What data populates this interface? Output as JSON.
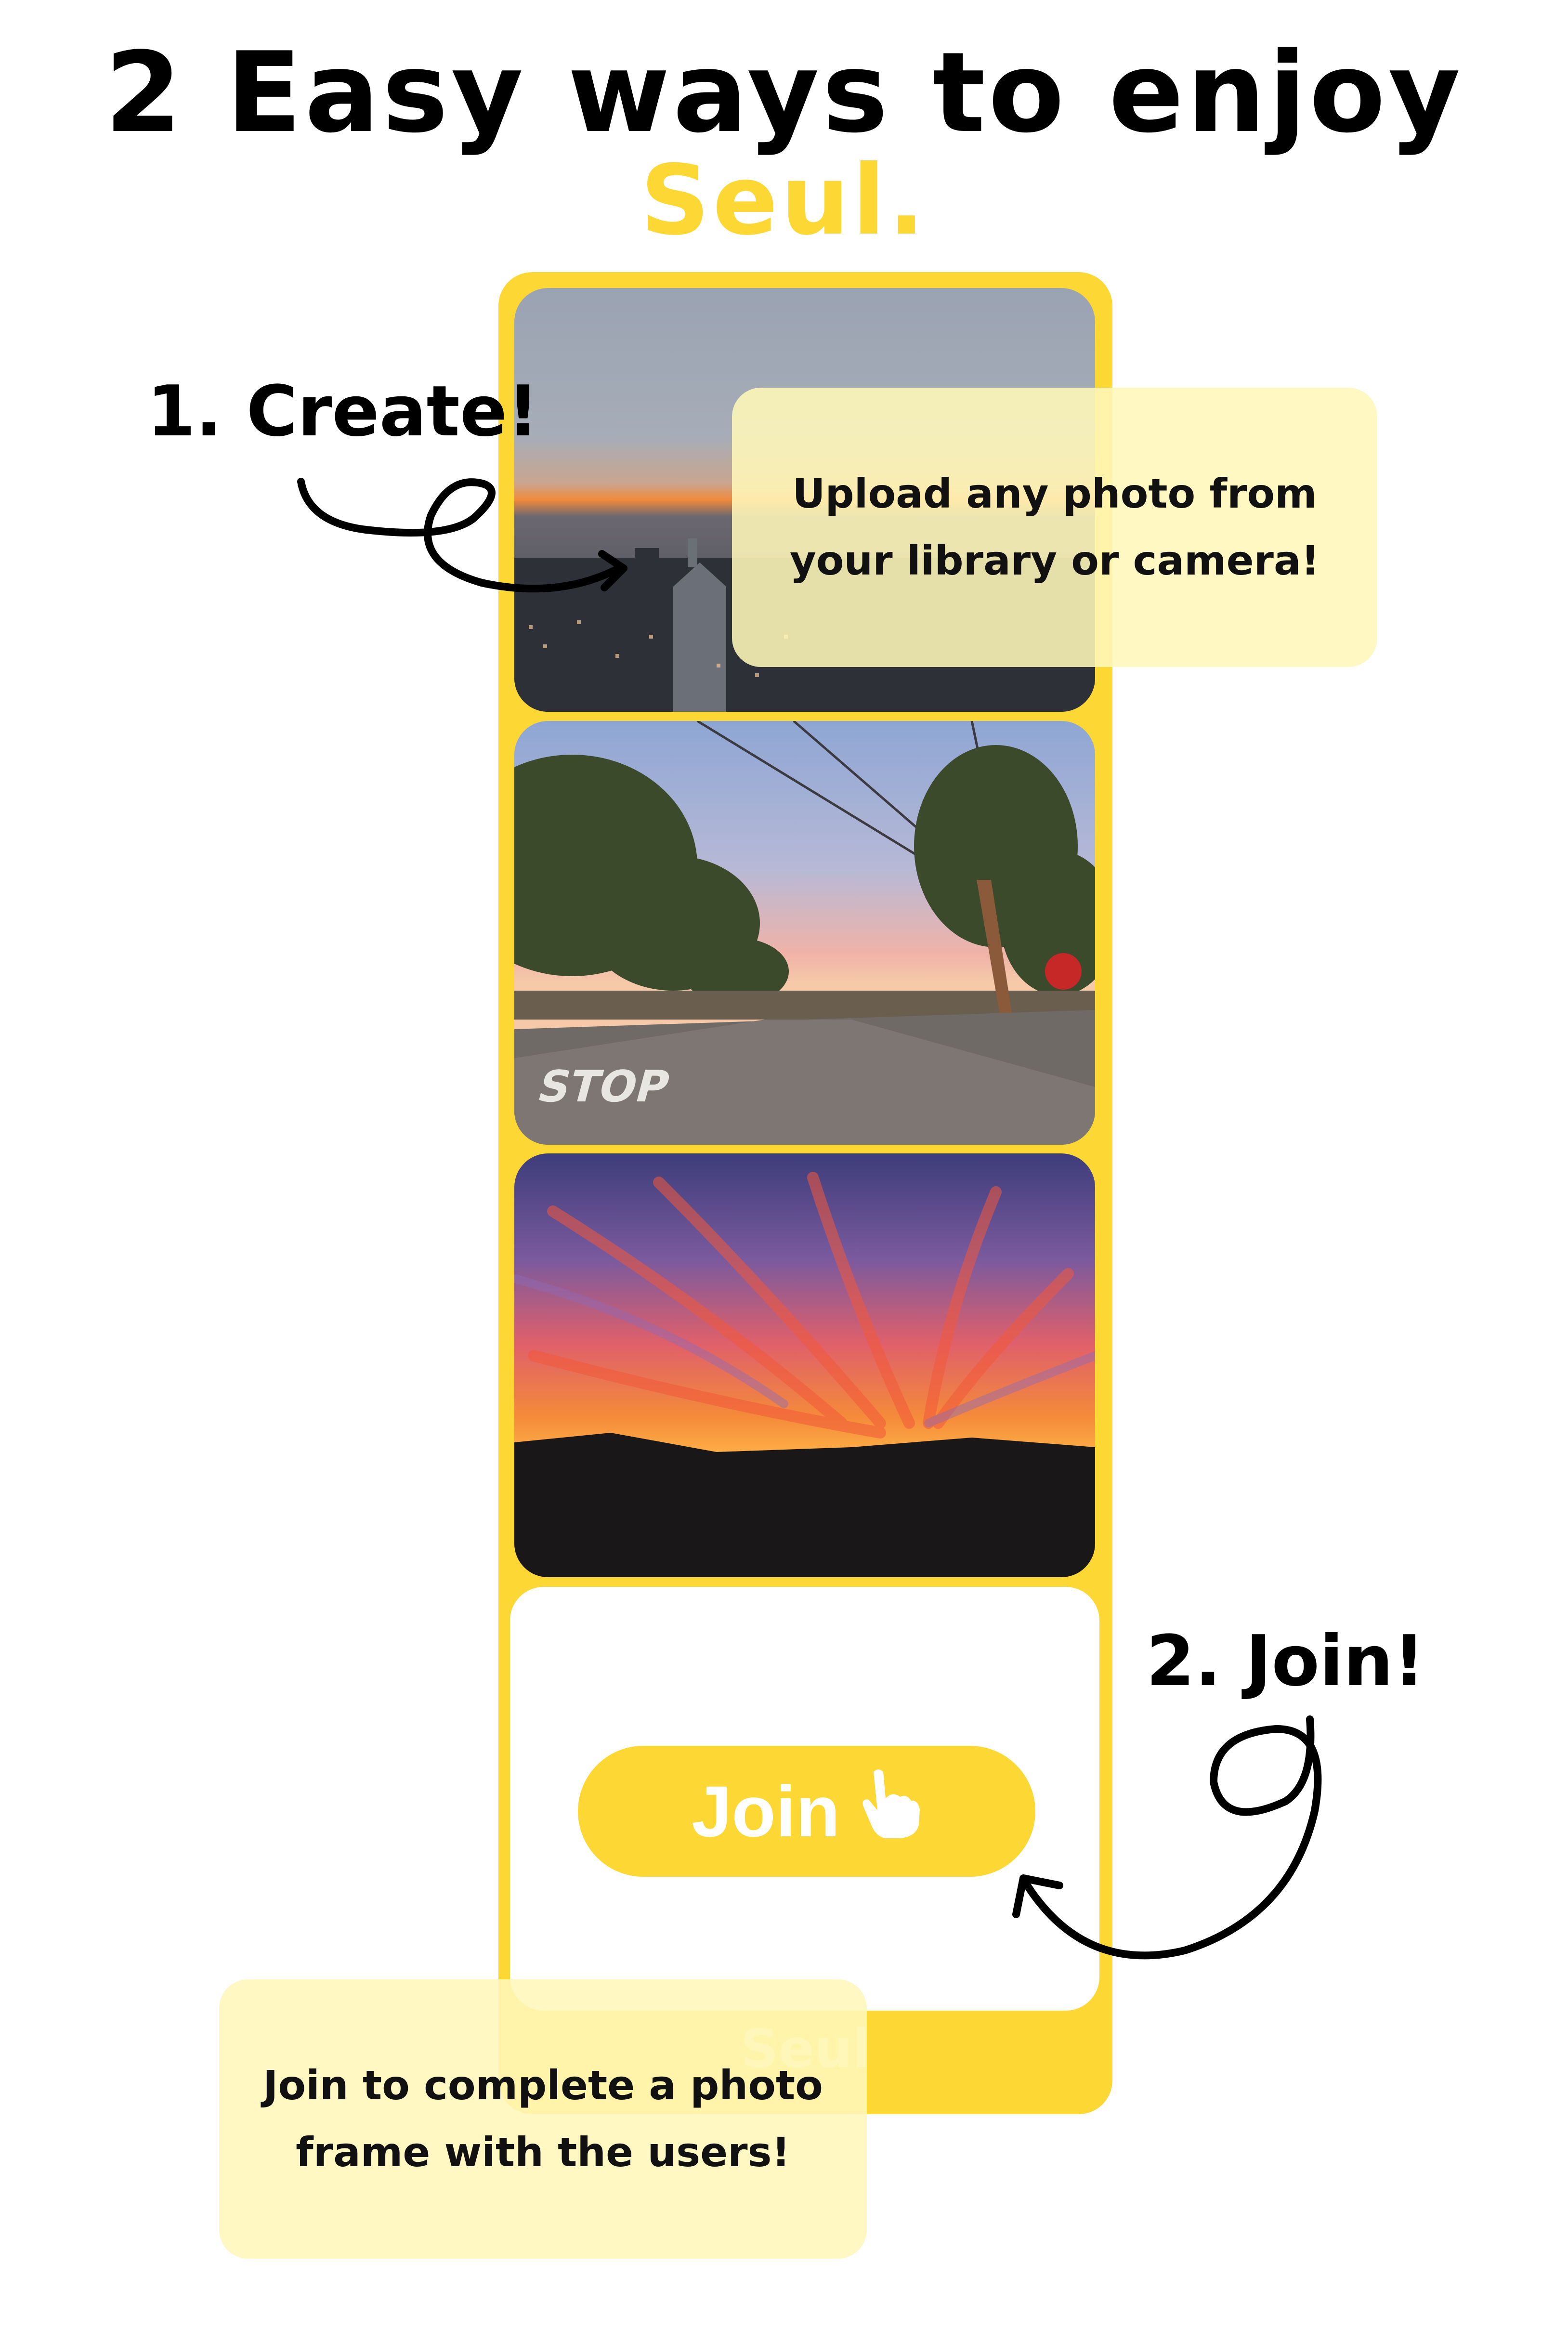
{
  "header": {
    "title_line1": "2 Easy ways to enjoy",
    "title_line2": "Seul."
  },
  "steps": {
    "create_label": "1. Create!",
    "create_description": "Upload any photo from your library or camera!",
    "join_label": "2. Join!",
    "join_description": "Join to complete a photo frame with the users!"
  },
  "frame": {
    "join_button_label": "Join",
    "join_button_icon": "pointing-hand-icon",
    "footer_label": "Seul"
  },
  "photos": [
    {
      "name": "city-skyline-photo",
      "road_marking": ""
    },
    {
      "name": "street-stop-photo",
      "road_marking": "STOP"
    },
    {
      "name": "sunset-sky-photo",
      "road_marking": ""
    }
  ],
  "colors": {
    "brand_yellow": "#fdd835",
    "note_background": "#fff7b9",
    "text": "#000000"
  }
}
